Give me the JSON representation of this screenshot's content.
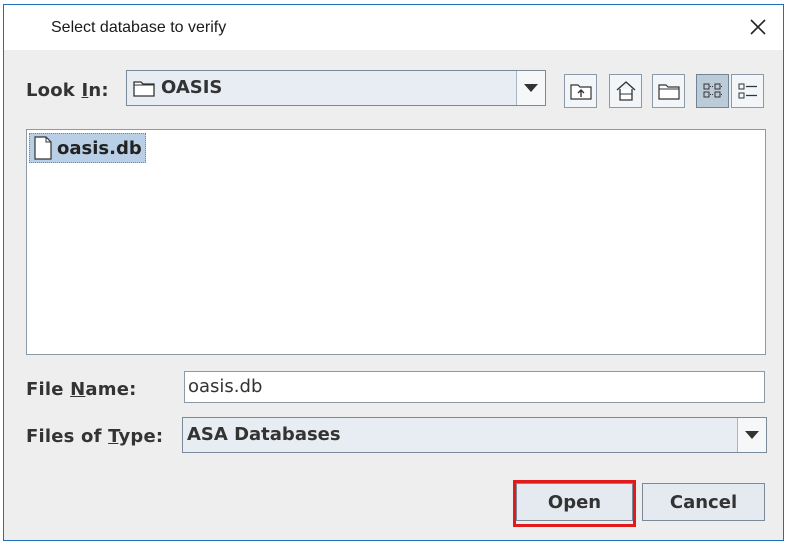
{
  "window": {
    "title": "Select database to verify"
  },
  "look_in": {
    "label_pre": "Look ",
    "label_mnemonic": "I",
    "label_post": "n:",
    "value": "OASIS"
  },
  "toolbar": {
    "up_one_level": "up-folder-icon",
    "home": "home-icon",
    "new_folder": "new-folder-icon",
    "list_view": "list-view-icon",
    "details_view": "details-view-icon"
  },
  "files": [
    {
      "name": "oasis.db",
      "selected": true
    }
  ],
  "file_name": {
    "label_pre": "File ",
    "label_mnemonic": "N",
    "label_post": "ame:",
    "value": "oasis.db"
  },
  "file_type": {
    "label_pre": "Files of ",
    "label_mnemonic": "T",
    "label_post": "ype:",
    "value": "ASA Databases"
  },
  "buttons": {
    "open": "Open",
    "cancel": "Cancel"
  },
  "colors": {
    "highlight": "#e11b1b",
    "selection": "#b8cfe5",
    "title_border": "#1d6fb8"
  }
}
